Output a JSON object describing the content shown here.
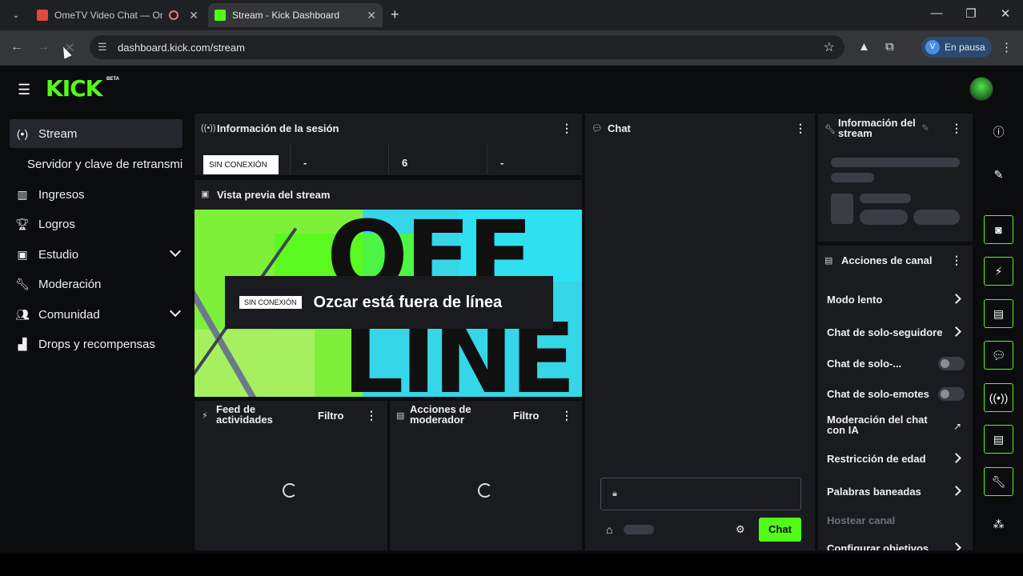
{
  "browser": {
    "tabs": [
      {
        "title": "OmeTV Video Chat — Ome",
        "active": false
      },
      {
        "title": "Stream - Kick Dashboard",
        "active": true
      }
    ],
    "new_tab": "+",
    "url": "dashboard.kick.com/stream",
    "profile_initial": "V",
    "profile_status": "En pausa",
    "controls": {
      "minimize": "—",
      "maximize": "❐",
      "close": "✕"
    }
  },
  "app": {
    "logo": "KICK",
    "logo_badge": "BETA",
    "accent": "#53fc18"
  },
  "sidebar": {
    "items": [
      {
        "label": "Stream",
        "icon": "stream-icon",
        "active": true
      },
      {
        "label": "Servidor y clave de retransmi",
        "icon": "",
        "active": false
      },
      {
        "label": "Ingresos",
        "icon": "chart-icon",
        "active": false
      },
      {
        "label": "Logros",
        "icon": "trophy-icon",
        "active": false
      },
      {
        "label": "Estudio",
        "icon": "studio-icon",
        "active": false,
        "expandable": true
      },
      {
        "label": "Moderación",
        "icon": "wrench-icon",
        "active": false
      },
      {
        "label": "Comunidad",
        "icon": "users-icon",
        "active": false,
        "expandable": true
      },
      {
        "label": "Drops y recompensas",
        "icon": "drops-icon",
        "active": false
      }
    ]
  },
  "session": {
    "title": "Información de la sesión",
    "status_badge": "SIN CONEXIÓN",
    "stats": [
      "-",
      "6",
      "-"
    ]
  },
  "preview": {
    "title": "Vista previa del stream",
    "badge": "SIN CONEXIÓN",
    "message": "Ozcar está fuera de línea",
    "art_text_top": "OFF",
    "art_text_bottom": "LINE"
  },
  "activity_feed": {
    "title": "Feed de actividades",
    "filter": "Filtro"
  },
  "mod_actions": {
    "title": "Acciones de moderador",
    "filter": "Filtro"
  },
  "chat": {
    "title": "Chat",
    "send_label": "Chat"
  },
  "stream_info": {
    "title": "Información del stream"
  },
  "channel_actions": {
    "title": "Acciones de canal",
    "items": [
      {
        "label": "Modo lento",
        "control": "chevron"
      },
      {
        "label": "Chat de solo-seguidore",
        "control": "chevron"
      },
      {
        "label": "Chat de solo-...",
        "control": "toggle",
        "on": false
      },
      {
        "label": "Chat de solo-emotes",
        "control": "toggle",
        "on": false
      },
      {
        "label": "Moderación del chat con IA",
        "control": "external"
      },
      {
        "label": "Restricción de edad",
        "control": "chevron"
      },
      {
        "label": "Palabras baneadas",
        "control": "chevron"
      },
      {
        "label": "Hostear canal",
        "control": "none",
        "disabled": true
      },
      {
        "label": "Configurar objetivos",
        "control": "chevron"
      }
    ]
  },
  "rail": [
    "info-icon",
    "edit-icon",
    "preview-icon",
    "lightning-icon",
    "notes-icon",
    "chat-icon",
    "broadcast-icon",
    "channel-actions-icon",
    "wrench-icon",
    "apps-icon"
  ]
}
